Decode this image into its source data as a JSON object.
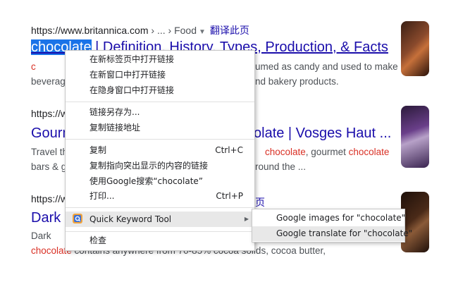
{
  "results": [
    {
      "url": "https://www.britannica.com",
      "crumb": " › ... › Food",
      "translate": "翻译此页",
      "title_selected": "chocolate",
      "title_rest": " | Definition, History, Types, Production, & Facts",
      "snippet_line1_red": "c",
      "snippet_line1_tail": "umed as candy and used to make",
      "snippet_line2_head": "beverag",
      "snippet_line2_tail": "nd bakery products."
    },
    {
      "url_fragment": "https://w",
      "title_head": "Gourm",
      "title_tail": "olate | Vosges Haut ...",
      "snippet_line1_head": "Travel th",
      "snippet_line1_em1": "chocolate",
      "snippet_line1_mid": ", gourmet ",
      "snippet_line1_em2": "chocolate",
      "snippet_line2_head": "bars & g",
      "snippet_line2_tail": "round the ..."
    },
    {
      "url_fragment": "https://w",
      "translate_fragment": "页",
      "title_head": "Dark C",
      "snippet_line1_head": "Dark ",
      "snippet_line2_em": "chocolate",
      "snippet_line2_tail": " contains anywhere from 70-85% cocoa solids, cocoa butter,"
    }
  ],
  "context_menu": {
    "items": [
      {
        "label": "在新标签页中打开链接"
      },
      {
        "label": "在新窗口中打开链接"
      },
      {
        "label": "在隐身窗口中打开链接"
      },
      {
        "label": "链接另存为..."
      },
      {
        "label": "复制链接地址"
      },
      {
        "label": "复制",
        "shortcut": "Ctrl+C"
      },
      {
        "label": "复制指向突出显示的内容的链接"
      },
      {
        "label": "使用Google搜索“chocolate”"
      },
      {
        "label": "打印...",
        "shortcut": "Ctrl+P"
      },
      {
        "label": "Quick Keyword Tool",
        "icon": "quick-keyword-tool-icon",
        "submenu_arrow": "▶"
      },
      {
        "label": "检查"
      }
    ]
  },
  "submenu": {
    "items": [
      {
        "label": "Google images for \"chocolate\""
      },
      {
        "label": "Google translate for \"chocolate\""
      }
    ]
  },
  "colors": {
    "link": "#1a0dab",
    "emphasis": "#d93025",
    "selection": "#1a73e8",
    "menu_highlight": "#e8e8e8"
  }
}
